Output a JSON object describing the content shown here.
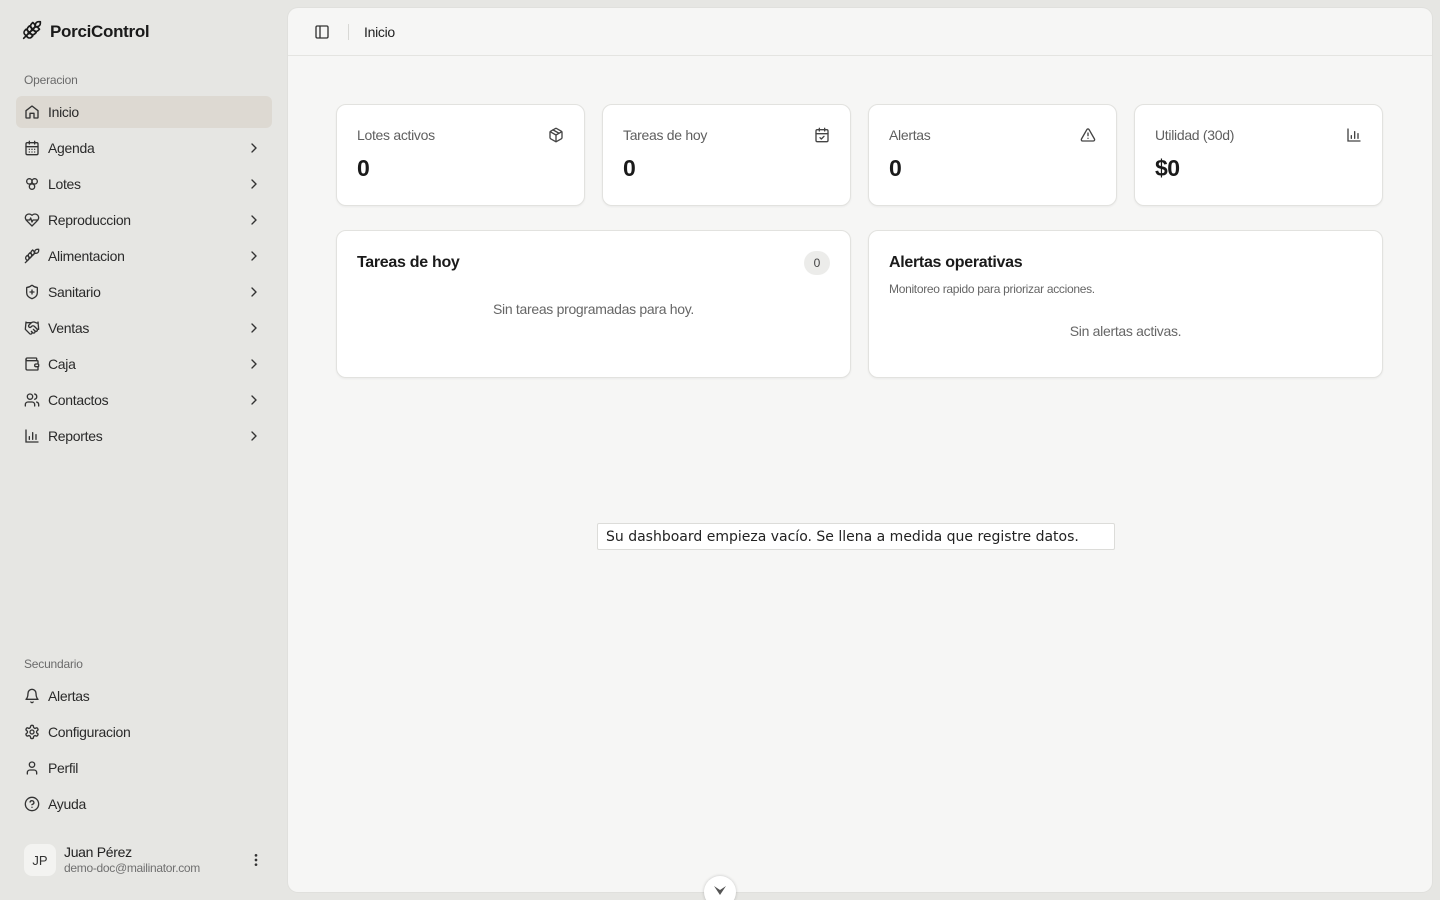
{
  "app": {
    "name": "PorciControl",
    "logo_icon": "pig-icon"
  },
  "sidebar": {
    "primary_label": "Operacion",
    "primary_items": [
      {
        "label": "Inicio",
        "icon": "home-icon",
        "active": true,
        "has_chevron": false
      },
      {
        "label": "Agenda",
        "icon": "calendar-icon",
        "has_chevron": true
      },
      {
        "label": "Lotes",
        "icon": "boxes-icon",
        "has_chevron": true
      },
      {
        "label": "Reproduccion",
        "icon": "heart-pulse-icon",
        "has_chevron": true
      },
      {
        "label": "Alimentacion",
        "icon": "wheat-icon",
        "has_chevron": true
      },
      {
        "label": "Sanitario",
        "icon": "shield-plus-icon",
        "has_chevron": true
      },
      {
        "label": "Ventas",
        "icon": "handshake-icon",
        "has_chevron": true
      },
      {
        "label": "Caja",
        "icon": "wallet-icon",
        "has_chevron": true
      },
      {
        "label": "Contactos",
        "icon": "users-icon",
        "has_chevron": true
      },
      {
        "label": "Reportes",
        "icon": "bar-chart-icon",
        "has_chevron": true
      }
    ],
    "secondary_label": "Secundario",
    "secondary_items": [
      {
        "label": "Alertas",
        "icon": "bell-icon"
      },
      {
        "label": "Configuracion",
        "icon": "gear-icon"
      },
      {
        "label": "Perfil",
        "icon": "user-icon"
      },
      {
        "label": "Ayuda",
        "icon": "help-circle-icon"
      }
    ],
    "user": {
      "initials": "JP",
      "name": "Juan Pérez",
      "email": "demo-doc@mailinator.com"
    }
  },
  "header": {
    "breadcrumb": "Inicio"
  },
  "stats": [
    {
      "title": "Lotes activos",
      "value": "0",
      "icon": "package-icon"
    },
    {
      "title": "Tareas de hoy",
      "value": "0",
      "icon": "calendar-check-icon"
    },
    {
      "title": "Alertas",
      "value": "0",
      "icon": "alert-triangle-icon"
    },
    {
      "title": "Utilidad (30d)",
      "value": "$0",
      "icon": "bar-chart-icon"
    }
  ],
  "tasks_panel": {
    "title": "Tareas de hoy",
    "count": "0",
    "empty": "Sin tareas programadas para hoy."
  },
  "alerts_panel": {
    "title": "Alertas operativas",
    "subtitle": "Monitoreo rapido para priorizar acciones.",
    "empty": "Sin alertas activas."
  },
  "hint": "Su dashboard empieza vacío. Se llena a medida que registre datos.",
  "colors": {
    "sidebar_bg": "#e6e6e3",
    "main_bg": "#f6f6f5",
    "active_item_bg": "#ddd9d2",
    "card_bg": "#ffffff"
  }
}
